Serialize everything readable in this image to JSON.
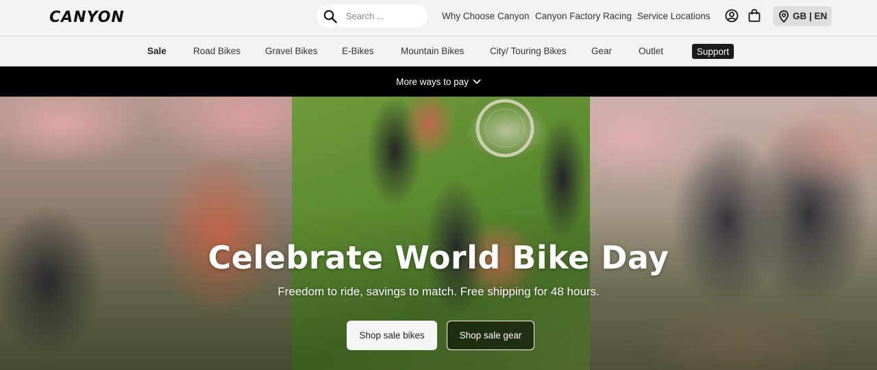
{
  "brand": {
    "logo_text": "CANYON"
  },
  "search": {
    "placeholder": "Search ...",
    "value": "",
    "icon": "search-icon"
  },
  "top_links": [
    "Why Choose Canyon",
    "Canyon Factory Racing",
    "Service Locations"
  ],
  "top_icons": [
    "account-icon",
    "cart-icon"
  ],
  "locale": {
    "label": "GB | EN",
    "icon": "location-pin-icon"
  },
  "categories": [
    "Sale",
    "Road Bikes",
    "Gravel Bikes",
    "E-Bikes",
    "Mountain Bikes",
    "City/ Touring Bikes",
    "Gear",
    "Outlet",
    "Support"
  ],
  "promo": {
    "label": "More ways to pay",
    "icon": "chevron-down-icon"
  },
  "hero": {
    "title": "Celebrate World Bike Day",
    "subtitle": "Freedom to ride, savings to match. Free shipping for 48 hours.",
    "primary_cta": "Shop sale bikes",
    "secondary_cta": "Shop sale gear"
  },
  "colors": {
    "header_bg": "#f2f2f2",
    "promo_bg": "#000000",
    "support_bg": "#1b1b1b",
    "text": "#333333"
  }
}
